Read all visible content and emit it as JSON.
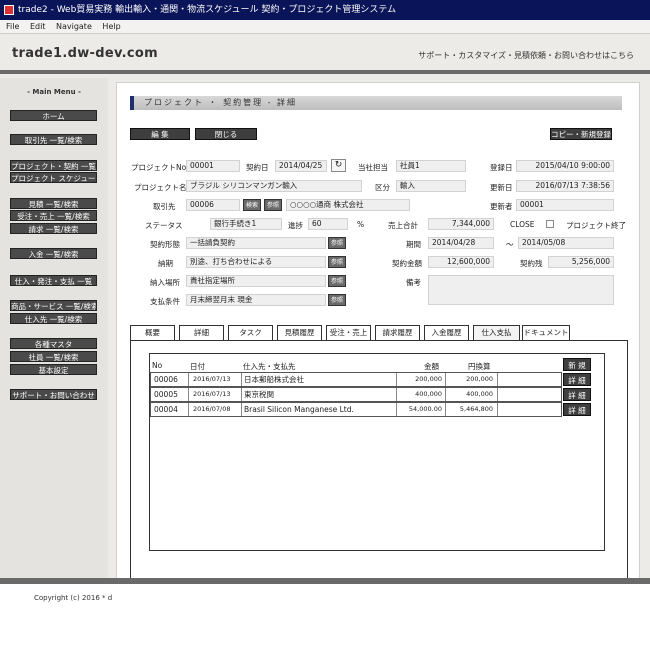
{
  "window": {
    "title": "trade2 - Web貿易実務 輸出輸入・通関・物流スケジュール 契約・プロジェクト管理システム"
  },
  "menubar": [
    "File",
    "Edit",
    "Navigate",
    "Help"
  ],
  "header": {
    "site": "trade1.dw-dev.com",
    "links": "サポート・カスタマイズ・見積依頼・お問い合わせはこちら"
  },
  "sidebar": {
    "title": "- Main Menu -",
    "items": [
      "ホーム",
      "取引先 一覧/検索",
      "プロジェクト・契約 一覧",
      "プロジェクト スケジュール",
      "見積 一覧/検索",
      "受注・売上 一覧/検索",
      "請求 一覧/検索",
      "入金 一覧/検索",
      "仕入・発注・支払 一覧",
      "商品・サービス 一覧/検索",
      "仕入先 一覧/検索",
      "各種マスタ",
      "社員 一覧/検索",
      "基本設定",
      "サポート・お問い合わせ"
    ]
  },
  "page": {
    "title": "プロジェクト ・ 契約管理 - 詳細"
  },
  "buttons": {
    "edit": "編 集",
    "close": "閉じる",
    "copy_new": "コピー・新規登録",
    "ref": "参照",
    "search": "検索",
    "new": "新 規",
    "detail": "詳 細"
  },
  "form": {
    "project_no_label": "プロジェクトNo",
    "project_no": "00001",
    "contract_date_label": "契約日",
    "contract_date": "2014/04/25",
    "staff_label": "当社担当",
    "staff": "社員1",
    "reg_date_label": "登録日",
    "reg_date": "2015/04/10 9:00:00",
    "project_name_label": "プロジェクト名",
    "project_name": "ブラジル シリコンマンガン輸入",
    "category_label": "区分",
    "category": "輸入",
    "upd_date_label": "更新日",
    "upd_date": "2016/07/13 7:38:56",
    "client_label": "取引先",
    "client_code": "00006",
    "client_name": "○○○○通商 株式会社",
    "updater_label": "更新者",
    "updater": "00001",
    "status_label": "ステータス",
    "status": "銀行手続き1",
    "progress_label": "進捗",
    "progress": "60",
    "progress_unit": "%",
    "sales_total_label": "売上合計",
    "sales_total": "7,344,000",
    "close_label": "CLOSE",
    "project_end_label": "プロジェクト終了",
    "contract_type_label": "契約形態",
    "contract_type": "一括請負契約",
    "period_label": "期間",
    "period_from": "2014/04/28",
    "period_sep": "～",
    "period_to": "2014/05/08",
    "delivery_label": "納期",
    "delivery": "別途、打ち合わせによる",
    "contract_amount_label": "契約金額",
    "contract_amount": "12,600,000",
    "remaining_label": "契約残",
    "remaining": "5,256,000",
    "place_label": "納入場所",
    "place": "貴社指定場所",
    "remarks_label": "備考",
    "payment_label": "支払条件",
    "payment": "月末締翌月末 現金"
  },
  "tabs": [
    "概要",
    "詳細",
    "タスク",
    "見積履歴",
    "受注・売上",
    "請求履歴",
    "入金履歴",
    "仕入支払",
    "ドキュメント"
  ],
  "table": {
    "headers": {
      "no": "No",
      "date": "日付",
      "vendor": "仕入先・支払先",
      "amount": "金額",
      "yen": "円換算"
    },
    "rows": [
      {
        "no": "00006",
        "date": "2016/07/13",
        "vendor": "日本郵船株式会社",
        "amount": "200,000",
        "yen": "200,000"
      },
      {
        "no": "00005",
        "date": "2016/07/13",
        "vendor": "東京税関",
        "amount": "400,000",
        "yen": "400,000"
      },
      {
        "no": "00004",
        "date": "2016/07/08",
        "vendor": "Brasil Silicon Manganese Ltd.",
        "amount": "54,000.00",
        "yen": "5,464,800"
      }
    ]
  },
  "footer": {
    "copyright": "Copyright (c) 2016 * d"
  }
}
